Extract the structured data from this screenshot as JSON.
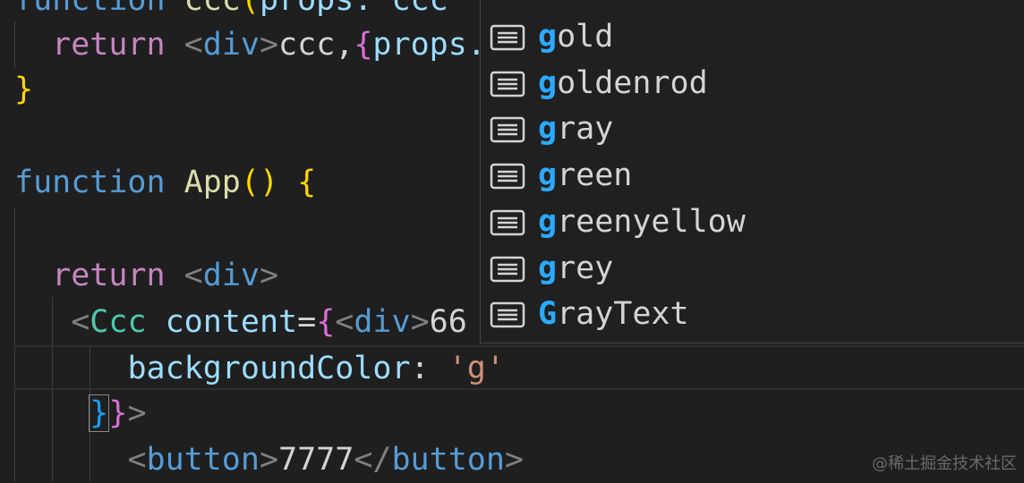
{
  "editor": {
    "line1": {
      "kw": "function",
      "name": "ccc",
      "open": "(",
      "rest": "props: ccc"
    },
    "line2": {
      "indent": "  ",
      "kw": "return",
      "tag_open": "<",
      "tag": "div",
      "tag_close": ">",
      "text": "ccc,",
      "brace": "{",
      "expr": "props."
    },
    "line3": {
      "brace": "}"
    },
    "line5": {
      "kw": "function",
      "name": "App",
      "parens": "()",
      "brace": "{"
    },
    "line7": {
      "indent": "  ",
      "kw": "return",
      "tag_open": "<",
      "tag": "div",
      "tag_close": ">"
    },
    "line8": {
      "indent": "   ",
      "lt": "<",
      "component": "Ccc",
      "attr": "content",
      "eq": "=",
      "brace": "{",
      "tag_lt": "<",
      "tag": "div",
      "tag_gt": ">",
      "text": "66"
    },
    "line9": {
      "indent": "      ",
      "prop": "backgroundColor",
      "colon": ":",
      "value": "'g'"
    },
    "line10": {
      "indent": "    ",
      "brace1": "}",
      "brace2": "}",
      "gt": ">"
    },
    "line11": {
      "indent": "      ",
      "lt": "<",
      "tag": "button",
      "gt": ">",
      "text": "7777",
      "close_lt": "</",
      "close_tag": "button",
      "close_gt": ">"
    }
  },
  "suggestions": [
    {
      "match": "g",
      "rest": "old",
      "icon": "value-text-icon"
    },
    {
      "match": "g",
      "rest": "oldenrod",
      "icon": "value-text-icon"
    },
    {
      "match": "g",
      "rest": "ray",
      "icon": "value-text-icon"
    },
    {
      "match": "g",
      "rest": "reen",
      "icon": "value-text-icon"
    },
    {
      "match": "g",
      "rest": "reenyellow",
      "icon": "value-text-icon"
    },
    {
      "match": "g",
      "rest": "rey",
      "icon": "value-text-icon"
    },
    {
      "match": "G",
      "rest": "rayText",
      "icon": "value-text-icon"
    }
  ],
  "watermark": "@稀土掘金技术社区",
  "colors": {
    "background": "#1f1f1f",
    "highlight": "#2aaaff",
    "keyword": "#c586c0",
    "function": "#569cd6"
  }
}
